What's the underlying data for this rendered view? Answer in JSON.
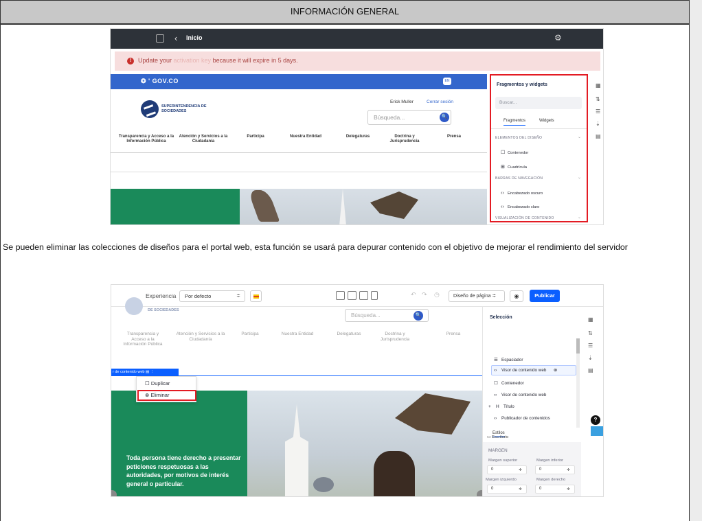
{
  "header": {
    "title": "INFORMACIÓN GENERAL"
  },
  "paragraph": "Se pueden eliminar las colecciones de diseños para el portal web, esta función se usará para depurar contenido con el objetivo de mejorar el rendimiento del servidor",
  "shot1": {
    "topbar": {
      "back_icon": "‹",
      "title": "Inicio",
      "settings_icon": "⚙"
    },
    "alert": {
      "pre": "Update your ",
      "link": "activation key",
      "post": " because it will expire in 5 days.",
      "icon": "!"
    },
    "site": {
      "gov_label": "❂ ' GOV.CO",
      "lang": "EN",
      "logo_text": "SUPERINTENDENCIA DE SOCIEDADES",
      "user": "Erick Muller",
      "logout": "Cerrar sesión",
      "search_placeholder": "Búsqueda...",
      "search_icon": "🔍",
      "nav": [
        "Transparencia y Acceso a la Información Pública",
        "Atención y Servicios a la Ciudadanía",
        "Participa",
        "Nuestra Entidad",
        "Delegaturas",
        "Doctrina y Jurisprudencia",
        "Prensa"
      ]
    },
    "panel": {
      "title": "Fragmentos y widgets",
      "search_placeholder": "Buscar...",
      "tabs": [
        "Fragmentos",
        "Widgets"
      ],
      "sections": [
        "ELEMENTOS DEL DISEÑO",
        "BARRAS DE NAVEGACIÓN",
        "VISUALIZACIÓN DE CONTENIDO"
      ],
      "items": [
        "Contenedor",
        "Cuadrícula",
        "Encabezado oscuro",
        "Encabezado claro"
      ],
      "item_icons": [
        "☐",
        "⊞",
        "‹›",
        "‹›"
      ],
      "chevron": "⌄"
    },
    "rail_icons": [
      "▦",
      "⇅",
      "☰",
      "⇣",
      "▤"
    ]
  },
  "shot2": {
    "toolbar": {
      "experience_label": "Experiencia",
      "experience_value": "Por defecto",
      "select_arrow": "≑",
      "undo_icons": [
        "↶",
        "↷",
        "◷"
      ],
      "design_label": "Diseño de página ≑",
      "preview_icon": "◉",
      "publish": "Publicar"
    },
    "site": {
      "logo_text": "DE SOCIEDADES",
      "search_placeholder": "Búsqueda...",
      "search_icon": "🔍",
      "nav": [
        "Transparencia y Acceso a la Información Pública",
        "Atención y Servicios a la Ciudadanía",
        "Participa",
        "Nuestra Entidad",
        "Delegaturas",
        "Doctrina y Jurisprudencia",
        "Prensa"
      ],
      "chip": "r de contenido web  ▤  ⋮",
      "banner_text": "Toda persona tiene derecho a presentar peticiones respetuosas a las autoridades, por motivos de interés general o particular."
    },
    "context_menu": {
      "items": [
        "Duplicar",
        "Eliminar"
      ],
      "icons": [
        "☐",
        "⊗"
      ]
    },
    "panel": {
      "title": "Selección",
      "tree": [
        {
          "icon": "☰",
          "label": "Espaciador"
        },
        {
          "icon": "‹›",
          "label": "Visor de contenido web"
        },
        {
          "icon": "☐",
          "label": "Contenedor"
        },
        {
          "icon": "‹›",
          "label": "Visor de contenido web"
        },
        {
          "icon": "H",
          "label": "Título"
        },
        {
          "icon": "‹›",
          "label": "Publicador de contenidos"
        }
      ],
      "remove_icon": "⊗",
      "expand_icon": "+",
      "styles_tab": "Estilos",
      "device": "Escritorio",
      "device_icon": "▭",
      "margin_heading": "MARGEN",
      "fields": [
        {
          "label": "Margen superior",
          "value": "0"
        },
        {
          "label": "Margen inferior",
          "value": "0"
        },
        {
          "label": "Margen izquierdo",
          "value": "0"
        },
        {
          "label": "Margen derecho",
          "value": "0"
        }
      ],
      "stepper_icon": "≑"
    },
    "rail_icons": [
      "▦",
      "⇅",
      "☰",
      "⇣",
      "▤"
    ],
    "badge": "?"
  }
}
